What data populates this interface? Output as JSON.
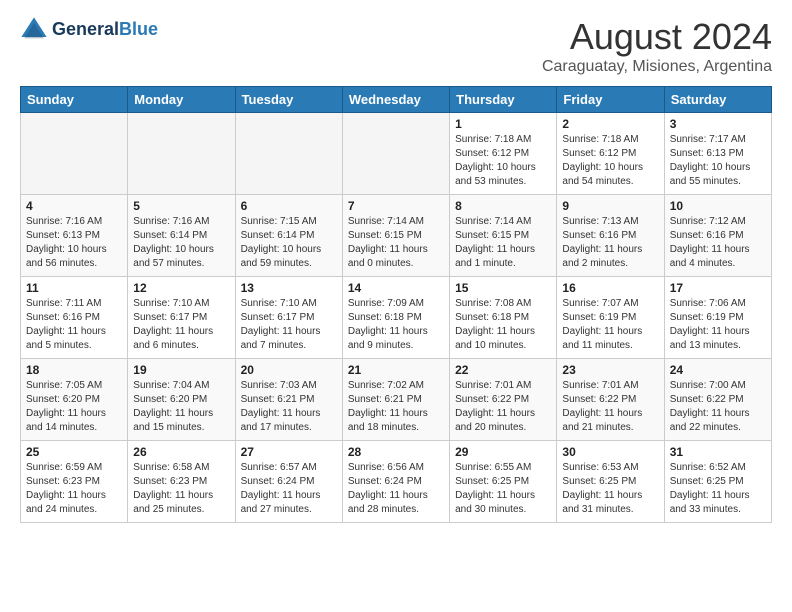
{
  "header": {
    "logo_line1": "General",
    "logo_line2": "Blue",
    "main_title": "August 2024",
    "subtitle": "Caraguatay, Misiones, Argentina"
  },
  "calendar": {
    "days_of_week": [
      "Sunday",
      "Monday",
      "Tuesday",
      "Wednesday",
      "Thursday",
      "Friday",
      "Saturday"
    ],
    "weeks": [
      [
        {
          "day": "",
          "info": ""
        },
        {
          "day": "",
          "info": ""
        },
        {
          "day": "",
          "info": ""
        },
        {
          "day": "",
          "info": ""
        },
        {
          "day": "1",
          "info": "Sunrise: 7:18 AM\nSunset: 6:12 PM\nDaylight: 10 hours\nand 53 minutes."
        },
        {
          "day": "2",
          "info": "Sunrise: 7:18 AM\nSunset: 6:12 PM\nDaylight: 10 hours\nand 54 minutes."
        },
        {
          "day": "3",
          "info": "Sunrise: 7:17 AM\nSunset: 6:13 PM\nDaylight: 10 hours\nand 55 minutes."
        }
      ],
      [
        {
          "day": "4",
          "info": "Sunrise: 7:16 AM\nSunset: 6:13 PM\nDaylight: 10 hours\nand 56 minutes."
        },
        {
          "day": "5",
          "info": "Sunrise: 7:16 AM\nSunset: 6:14 PM\nDaylight: 10 hours\nand 57 minutes."
        },
        {
          "day": "6",
          "info": "Sunrise: 7:15 AM\nSunset: 6:14 PM\nDaylight: 10 hours\nand 59 minutes."
        },
        {
          "day": "7",
          "info": "Sunrise: 7:14 AM\nSunset: 6:15 PM\nDaylight: 11 hours\nand 0 minutes."
        },
        {
          "day": "8",
          "info": "Sunrise: 7:14 AM\nSunset: 6:15 PM\nDaylight: 11 hours\nand 1 minute."
        },
        {
          "day": "9",
          "info": "Sunrise: 7:13 AM\nSunset: 6:16 PM\nDaylight: 11 hours\nand 2 minutes."
        },
        {
          "day": "10",
          "info": "Sunrise: 7:12 AM\nSunset: 6:16 PM\nDaylight: 11 hours\nand 4 minutes."
        }
      ],
      [
        {
          "day": "11",
          "info": "Sunrise: 7:11 AM\nSunset: 6:16 PM\nDaylight: 11 hours\nand 5 minutes."
        },
        {
          "day": "12",
          "info": "Sunrise: 7:10 AM\nSunset: 6:17 PM\nDaylight: 11 hours\nand 6 minutes."
        },
        {
          "day": "13",
          "info": "Sunrise: 7:10 AM\nSunset: 6:17 PM\nDaylight: 11 hours\nand 7 minutes."
        },
        {
          "day": "14",
          "info": "Sunrise: 7:09 AM\nSunset: 6:18 PM\nDaylight: 11 hours\nand 9 minutes."
        },
        {
          "day": "15",
          "info": "Sunrise: 7:08 AM\nSunset: 6:18 PM\nDaylight: 11 hours\nand 10 minutes."
        },
        {
          "day": "16",
          "info": "Sunrise: 7:07 AM\nSunset: 6:19 PM\nDaylight: 11 hours\nand 11 minutes."
        },
        {
          "day": "17",
          "info": "Sunrise: 7:06 AM\nSunset: 6:19 PM\nDaylight: 11 hours\nand 13 minutes."
        }
      ],
      [
        {
          "day": "18",
          "info": "Sunrise: 7:05 AM\nSunset: 6:20 PM\nDaylight: 11 hours\nand 14 minutes."
        },
        {
          "day": "19",
          "info": "Sunrise: 7:04 AM\nSunset: 6:20 PM\nDaylight: 11 hours\nand 15 minutes."
        },
        {
          "day": "20",
          "info": "Sunrise: 7:03 AM\nSunset: 6:21 PM\nDaylight: 11 hours\nand 17 minutes."
        },
        {
          "day": "21",
          "info": "Sunrise: 7:02 AM\nSunset: 6:21 PM\nDaylight: 11 hours\nand 18 minutes."
        },
        {
          "day": "22",
          "info": "Sunrise: 7:01 AM\nSunset: 6:22 PM\nDaylight: 11 hours\nand 20 minutes."
        },
        {
          "day": "23",
          "info": "Sunrise: 7:01 AM\nSunset: 6:22 PM\nDaylight: 11 hours\nand 21 minutes."
        },
        {
          "day": "24",
          "info": "Sunrise: 7:00 AM\nSunset: 6:22 PM\nDaylight: 11 hours\nand 22 minutes."
        }
      ],
      [
        {
          "day": "25",
          "info": "Sunrise: 6:59 AM\nSunset: 6:23 PM\nDaylight: 11 hours\nand 24 minutes."
        },
        {
          "day": "26",
          "info": "Sunrise: 6:58 AM\nSunset: 6:23 PM\nDaylight: 11 hours\nand 25 minutes."
        },
        {
          "day": "27",
          "info": "Sunrise: 6:57 AM\nSunset: 6:24 PM\nDaylight: 11 hours\nand 27 minutes."
        },
        {
          "day": "28",
          "info": "Sunrise: 6:56 AM\nSunset: 6:24 PM\nDaylight: 11 hours\nand 28 minutes."
        },
        {
          "day": "29",
          "info": "Sunrise: 6:55 AM\nSunset: 6:25 PM\nDaylight: 11 hours\nand 30 minutes."
        },
        {
          "day": "30",
          "info": "Sunrise: 6:53 AM\nSunset: 6:25 PM\nDaylight: 11 hours\nand 31 minutes."
        },
        {
          "day": "31",
          "info": "Sunrise: 6:52 AM\nSunset: 6:25 PM\nDaylight: 11 hours\nand 33 minutes."
        }
      ]
    ]
  }
}
